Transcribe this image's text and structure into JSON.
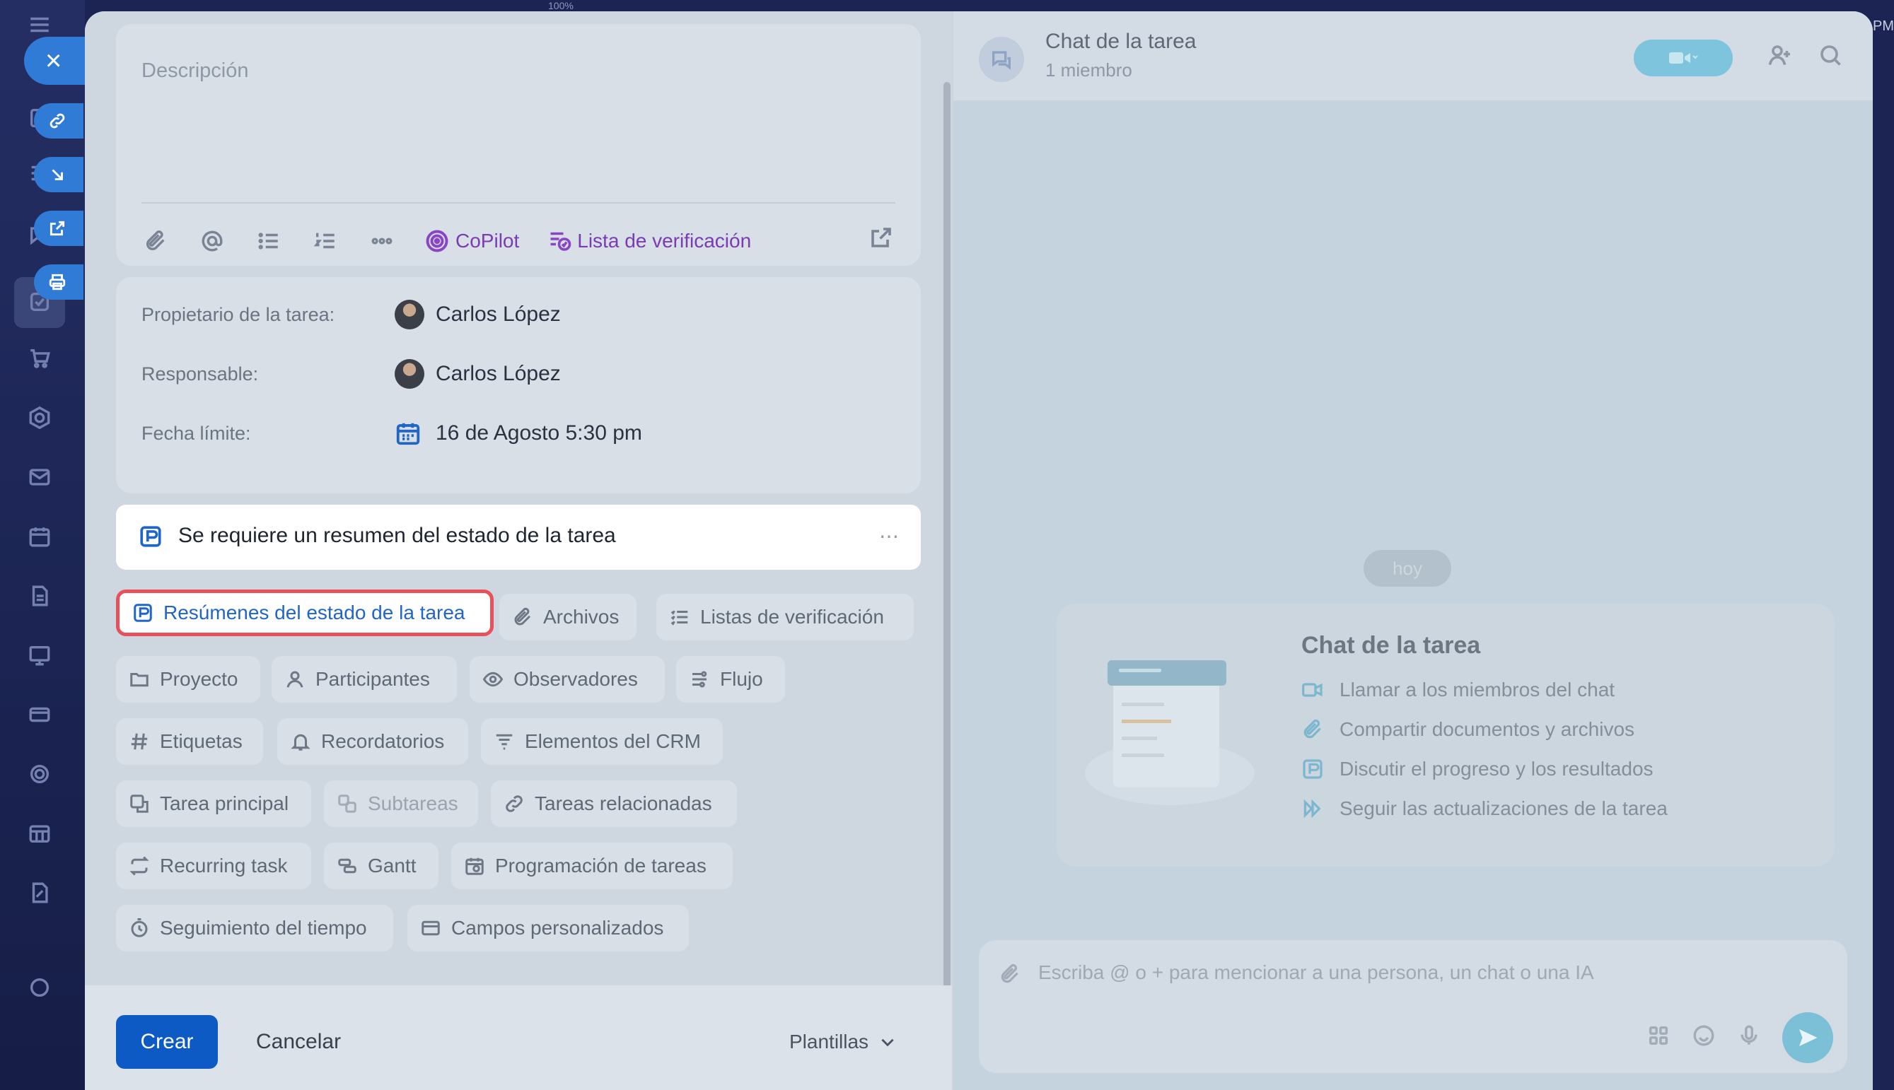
{
  "top": {
    "zoom": "100%",
    "clock": "PM"
  },
  "description": {
    "placeholder": "Descripción",
    "copilot_label": "CoPilot",
    "checklist_label": "Lista de verificación"
  },
  "meta": {
    "owner_label": "Propietario de la tarea:",
    "owner_value": "Carlos López",
    "responsible_label": "Responsable:",
    "responsible_value": "Carlos López",
    "deadline_label": "Fecha límite:",
    "deadline_value": "16 de Agosto 5:30 pm"
  },
  "summary_banner": {
    "text": "Se requiere un resumen del estado de la tarea",
    "more": "⋯"
  },
  "chips": {
    "status_summaries": "Resúmenes del estado de la tarea",
    "files": "Archivos",
    "checklists": "Listas de verificación",
    "project": "Proyecto",
    "participants": "Participantes",
    "observers": "Observadores",
    "flow": "Flujo",
    "tags": "Etiquetas",
    "reminders": "Recordatorios",
    "crm": "Elementos del CRM",
    "parent_task": "Tarea principal",
    "subtasks": "Subtareas",
    "related_tasks": "Tareas relacionadas",
    "recurring": "Recurring task",
    "gantt": "Gantt",
    "scheduling": "Programación de tareas",
    "time_tracking": "Seguimiento del tiempo",
    "custom_fields": "Campos personalizados"
  },
  "footer": {
    "create": "Crear",
    "cancel": "Cancelar",
    "templates": "Plantillas"
  },
  "chat": {
    "title": "Chat de la tarea",
    "subtitle": "1 miembro",
    "day": "hoy",
    "empty_title": "Chat de la tarea",
    "items": [
      "Llamar a los miembros del chat",
      "Compartir documentos y archivos",
      "Discutir el progreso y los resultados",
      "Seguir las actualizaciones de la tarea"
    ],
    "composer_placeholder": "Escriba @ o + para mencionar a una persona, un chat o una IA"
  },
  "colors": {
    "primary": "#0d5ac4",
    "accent_purple": "#7a3bb3",
    "highlight_border": "#e8505b",
    "sidebar_bg": "#1b2452"
  }
}
